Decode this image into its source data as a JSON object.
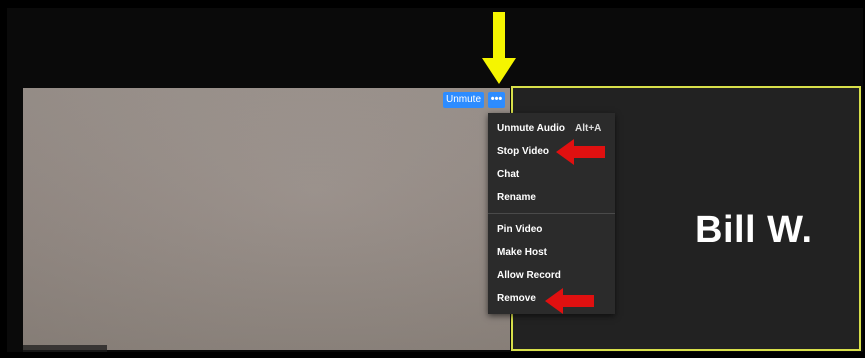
{
  "call_controls": {
    "unmute_label": "Unmute",
    "more_label": "•••"
  },
  "participant": {
    "name": "Bill W."
  },
  "context_menu": {
    "items": [
      {
        "label": "Unmute Audio",
        "shortcut": "Alt+A"
      },
      {
        "label": "Stop Video"
      },
      {
        "label": "Chat"
      },
      {
        "label": "Rename"
      },
      {
        "label": "Pin Video"
      },
      {
        "label": "Make Host"
      },
      {
        "label": "Allow Record"
      },
      {
        "label": "Remove"
      }
    ]
  },
  "colors": {
    "accent_blue": "#2d8cff",
    "active_speaker_border": "#d8e04a",
    "annotation_yellow": "#f5f500",
    "annotation_red": "#e01010"
  },
  "annotations": {
    "arrow_1": "yellow-down-arrow-icon",
    "arrow_2": "red-left-arrow-icon"
  }
}
